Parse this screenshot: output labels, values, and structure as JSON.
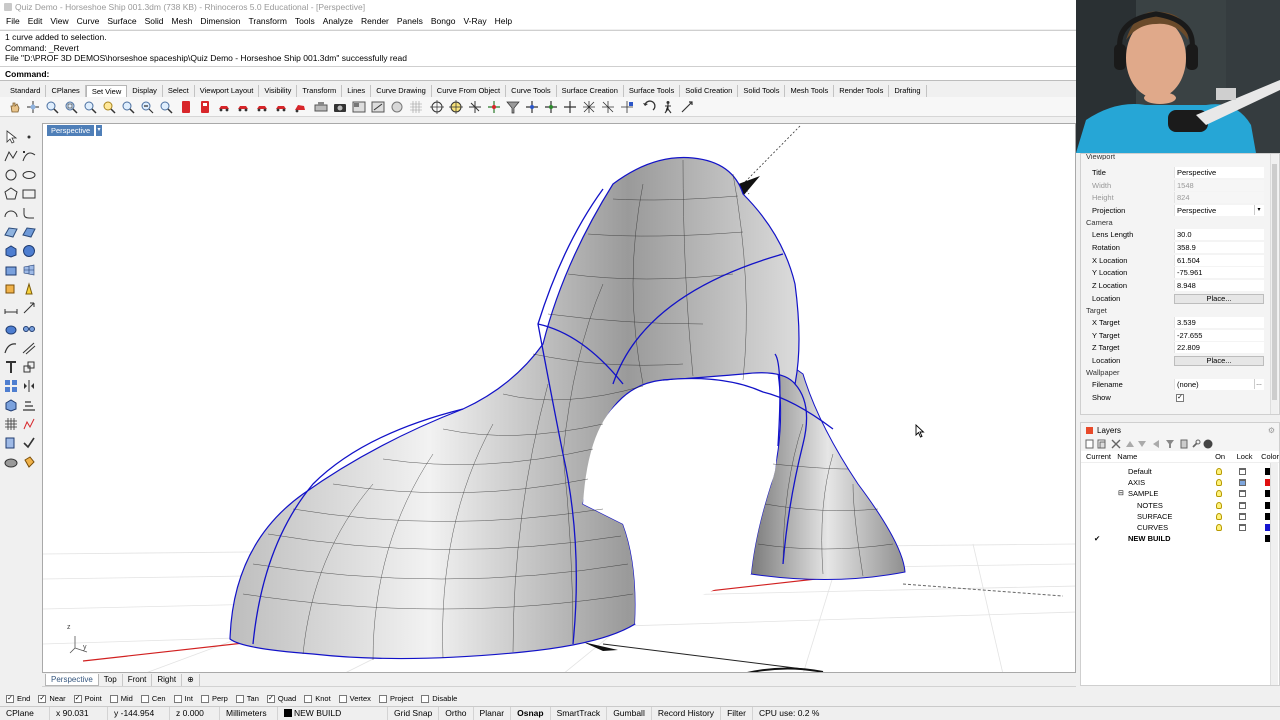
{
  "window": {
    "title": "Quiz Demo - Horseshoe Ship 001.3dm (738 KB) - Rhinoceros 5.0 Educational - [Perspective]"
  },
  "menu": [
    "File",
    "Edit",
    "View",
    "Curve",
    "Surface",
    "Solid",
    "Mesh",
    "Dimension",
    "Transform",
    "Tools",
    "Analyze",
    "Render",
    "Panels",
    "Bongo",
    "V-Ray",
    "Help"
  ],
  "command_history": [
    "1 curve added to selection.",
    "Command: _Revert",
    "File \"D:\\PROF 3D DEMOS\\horseshoe spaceship\\Quiz Demo - Horseshoe Ship 001.3dm\" successfully read"
  ],
  "command_prompt": "Command:",
  "toolbar_tabs": [
    "Standard",
    "CPlanes",
    "Set View",
    "Display",
    "Select",
    "Viewport Layout",
    "Visibility",
    "Transform",
    "Lines",
    "Curve Drawing",
    "Curve From Object",
    "Curve Tools",
    "Surface Creation",
    "Surface Tools",
    "Solid Creation",
    "Solid Tools",
    "Mesh Tools",
    "Render Tools",
    "Drafting"
  ],
  "toolbar_tabs_active": "Set View",
  "viewport": {
    "title": "Perspective",
    "dropdown_glyph": "▾",
    "axes": {
      "x": "x",
      "y": "y",
      "z": "z"
    },
    "colors": {
      "surface_edge": "#1212c8",
      "x_axis": "#d12020",
      "grid": "#dcdcdc"
    }
  },
  "viewport_tabs": [
    "Perspective",
    "Top",
    "Front",
    "Right"
  ],
  "viewport_tabs_add": "⊕",
  "osnaps": [
    {
      "label": "End",
      "checked": true
    },
    {
      "label": "Near",
      "checked": true
    },
    {
      "label": "Point",
      "checked": true
    },
    {
      "label": "Mid",
      "checked": false
    },
    {
      "label": "Cen",
      "checked": false
    },
    {
      "label": "Int",
      "checked": false
    },
    {
      "label": "Perp",
      "checked": false
    },
    {
      "label": "Tan",
      "checked": false
    },
    {
      "label": "Quad",
      "checked": true
    },
    {
      "label": "Knot",
      "checked": false
    },
    {
      "label": "Vertex",
      "checked": false
    },
    {
      "label": "Project",
      "checked": false
    },
    {
      "label": "Disable",
      "checked": false
    }
  ],
  "status": {
    "cplane": "CPlane",
    "x": "x 90.031",
    "y": "y -144.954",
    "z": "z 0.000",
    "units": "Millimeters",
    "layer": "NEW BUILD",
    "grid_snap": "Grid Snap",
    "ortho": "Ortho",
    "planar": "Planar",
    "osnap": "Osnap",
    "smarttrack": "SmartTrack",
    "gumball": "Gumball",
    "record_history": "Record History",
    "filter": "Filter",
    "cpu": "CPU use: 0.2 %"
  },
  "properties": {
    "viewport_header": "Viewport",
    "title_label": "Title",
    "title_value": "Perspective",
    "width_label": "Width",
    "width_value": "1548",
    "height_label": "Height",
    "height_value": "824",
    "projection_label": "Projection",
    "projection_value": "Perspective",
    "camera_header": "Camera",
    "lens_label": "Lens Length",
    "lens_value": "30.0",
    "rotation_label": "Rotation",
    "rotation_value": "358.9",
    "xloc_label": "X Location",
    "xloc_value": "61.504",
    "yloc_label": "Y Location",
    "yloc_value": "-75.961",
    "zloc_label": "Z Location",
    "zloc_value": "8.948",
    "location_label": "Location",
    "place_label": "Place...",
    "target_header": "Target",
    "xtgt_label": "X Target",
    "xtgt_value": "3.539",
    "ytgt_label": "Y Target",
    "ytgt_value": "-27.655",
    "ztgt_label": "Z Target",
    "ztgt_value": "22.809",
    "tloc_label": "Location",
    "tplace_label": "Place...",
    "wallpaper_header": "Wallpaper",
    "filename_label": "Filename",
    "filename_value": "(none)",
    "show_label": "Show"
  },
  "layers": {
    "title": "Layers",
    "columns": [
      "Current",
      "Name",
      "On",
      "Lock",
      "Color"
    ],
    "rows": [
      {
        "name": "Default",
        "color": "#000000",
        "current": false
      },
      {
        "name": "AXIS",
        "color": "#e01010",
        "current": false
      },
      {
        "name": "SAMPLE",
        "color": "#000000",
        "current": false
      },
      {
        "name": "NOTES",
        "color": "#000000",
        "current": false
      },
      {
        "name": "SURFACE",
        "color": "#000000",
        "current": false
      },
      {
        "name": "CURVES",
        "color": "#1515d0",
        "current": false
      },
      {
        "name": "NEW BUILD",
        "color": "#000000",
        "current": true
      }
    ],
    "current_mark": "✔",
    "expand_glyph": "⊟"
  }
}
